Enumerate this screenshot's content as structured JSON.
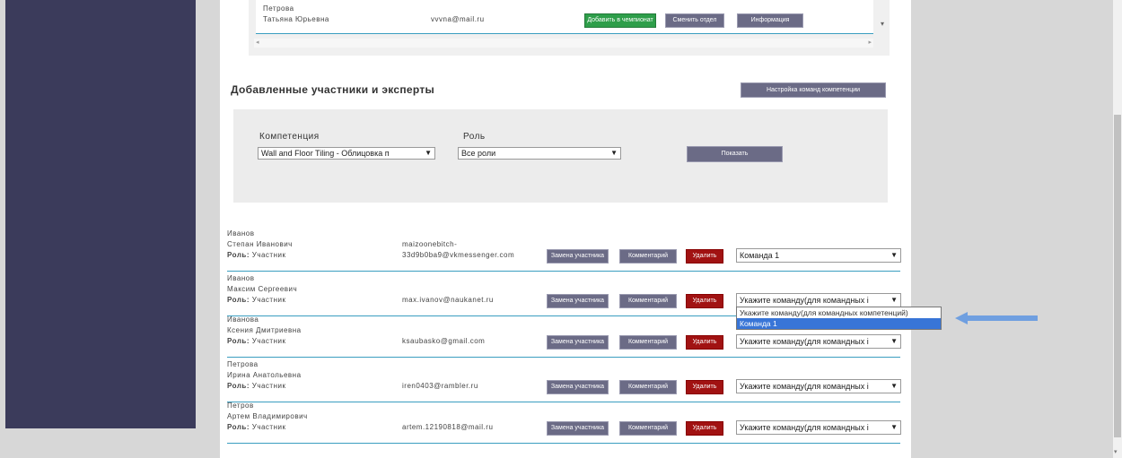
{
  "top_panel": {
    "row": {
      "last_name": "Петрова",
      "first_name": "Татьяна Юрьевна",
      "email": "vvvna@mail.ru",
      "buttons": [
        "Добавить в чемпионат",
        "Сменить отдел",
        "Информация"
      ]
    }
  },
  "section": {
    "title": "Добавленные участники и эксперты",
    "settings_button": "Настройка команд компетенции"
  },
  "filter": {
    "competence_label": "Компетенция",
    "competence_value": "Wall and Floor Tiling - Облицовка п",
    "role_label": "Роль",
    "role_value": "Все роли",
    "show_button": "Показать"
  },
  "labels": {
    "role_prefix": "Роль:",
    "replace_button": "Замена участника",
    "comment_button": "Комментарий",
    "delete_button": "Удалить"
  },
  "participants": [
    {
      "last_name": "Иванов",
      "first_name": "Степан Иванович",
      "role": "Участник",
      "email_1": "maizoonebitch-",
      "email_2": "33d9b0ba9@vkmessenger.com",
      "team": "Команда 1"
    },
    {
      "last_name": "Иванов",
      "first_name": "Максим Сергеевич",
      "role": "Участник",
      "email_1": "",
      "email_2": "max.ivanov@naukanet.ru",
      "team": "Укажите команду(для командных і"
    },
    {
      "last_name": "Иванова",
      "first_name": "Ксения Дмитриевна",
      "role": "Участник",
      "email_1": "",
      "email_2": "ksaubasko@gmail.com",
      "team": "Укажите команду(для командных і"
    },
    {
      "last_name": "Петрова",
      "first_name": "Ирина Анатольевна",
      "role": "Участник",
      "email_1": "",
      "email_2": "iren0403@rambler.ru",
      "team": "Укажите команду(для командных і"
    },
    {
      "last_name": "Петров",
      "first_name": "Артем Владимирович",
      "role": "Участник",
      "email_1": "",
      "email_2": "artem.12190818@mail.ru",
      "team": "Укажите команду(для командных і"
    }
  ],
  "dropdown": {
    "options": [
      "Укажите команду(для командных компетенций)",
      "Команда 1"
    ],
    "highlighted_index": 1
  },
  "colors": {
    "sidebar": "#3b3b5b",
    "button": "#6b6b86",
    "add_button": "#2e9e4a",
    "delete_button": "#a11212",
    "separator": "#3a9ec0",
    "arrow": "#6f9fe0",
    "highlight": "#3875d7"
  },
  "icons": {
    "select_caret": "▼",
    "scroll_left": "◂",
    "scroll_right": "▸",
    "scroll_down": "▾"
  }
}
